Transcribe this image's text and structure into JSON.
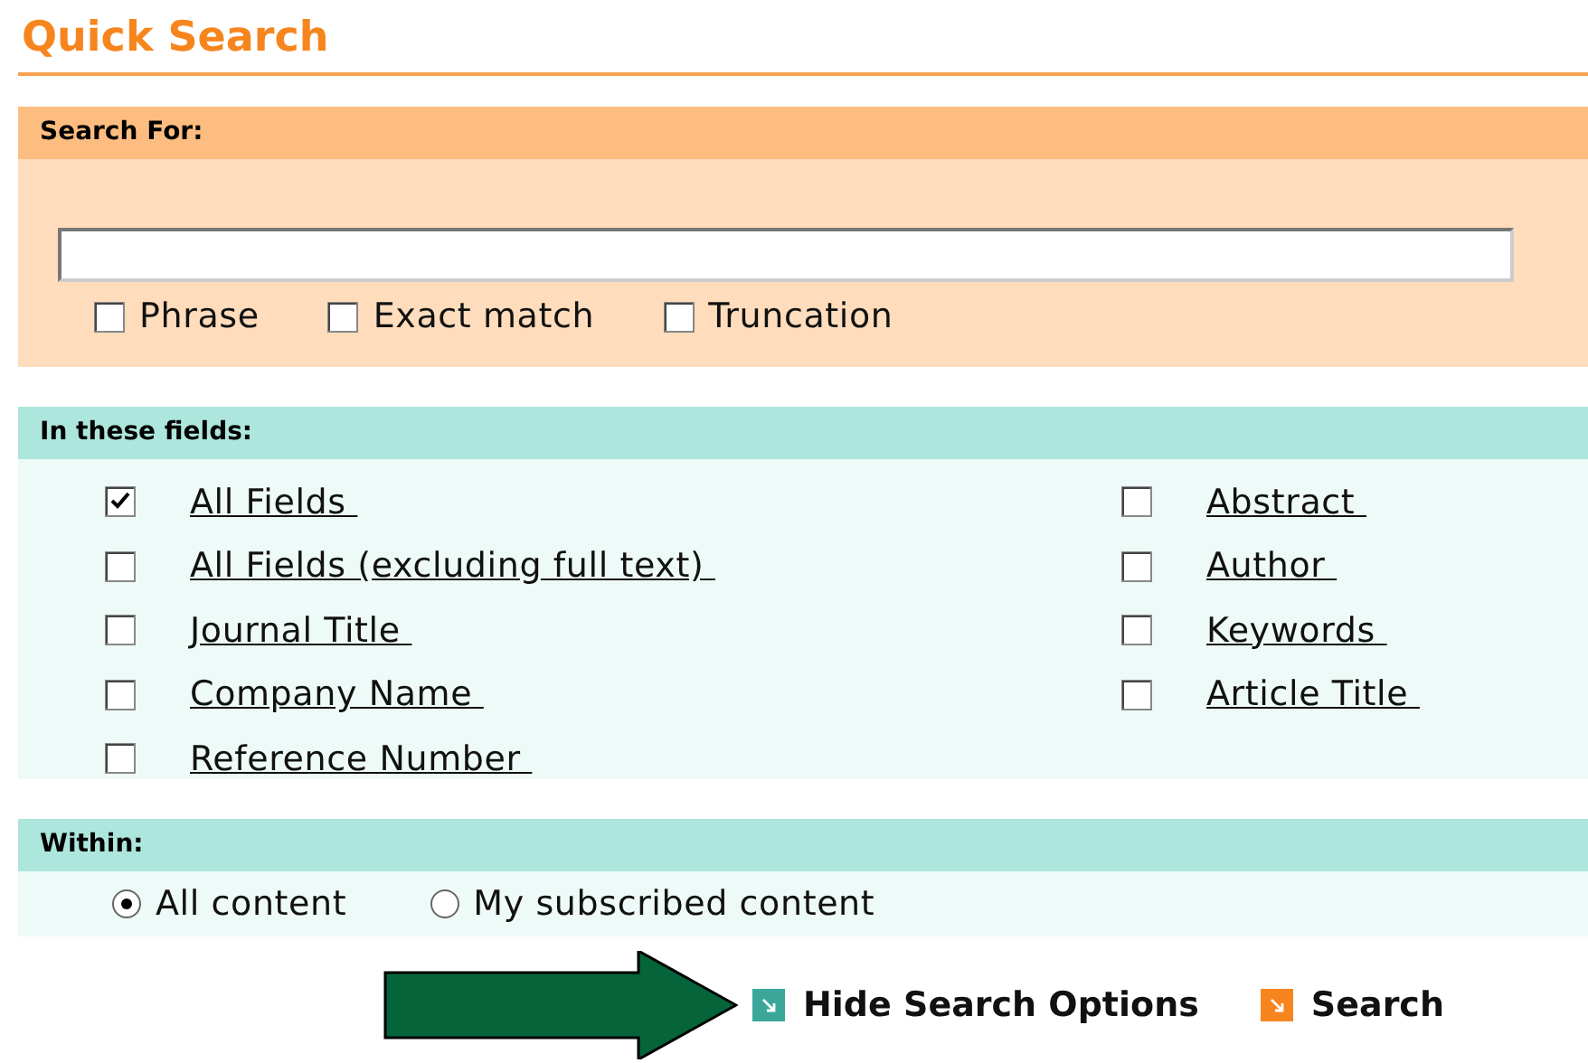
{
  "title": "Quick Search",
  "search_for": {
    "heading": "Search For:",
    "options": [
      {
        "label": "Phrase",
        "checked": false
      },
      {
        "label": "Exact match",
        "checked": false
      },
      {
        "label": "Truncation",
        "checked": false
      }
    ]
  },
  "fields": {
    "heading": "In these fields:",
    "columns": [
      [
        {
          "label": "All Fields",
          "checked": true
        },
        {
          "label": "All Fields (excluding full text)",
          "checked": false
        },
        {
          "label": "Journal Title",
          "checked": false
        },
        {
          "label": "Company Name",
          "checked": false
        },
        {
          "label": "Reference Number",
          "checked": false
        }
      ],
      [
        {
          "label": "Abstract",
          "checked": false
        },
        {
          "label": "Author",
          "checked": false
        },
        {
          "label": "Keywords",
          "checked": false
        },
        {
          "label": "Article Title",
          "checked": false
        }
      ]
    ]
  },
  "within": {
    "heading": "Within:",
    "options": [
      {
        "label": "All content",
        "selected": true
      },
      {
        "label": "My subscribed content",
        "selected": false
      }
    ]
  },
  "actions": [
    {
      "label": "Hide Search Options",
      "color": "#3aa79a"
    },
    {
      "label": "Search",
      "color": "#f7851e"
    }
  ]
}
